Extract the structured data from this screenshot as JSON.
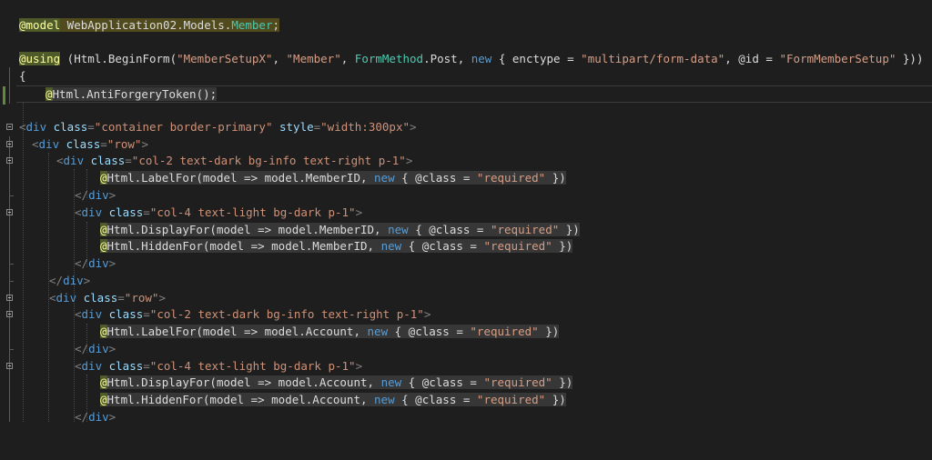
{
  "editor": {
    "lines": {
      "l1": {
        "at": "@model",
        "text": " WebApplication02.Models.",
        "type": "Member",
        "semi": ";"
      },
      "l2": {
        "at": "@using",
        "a": " (Html.BeginForm(",
        "s1": "\"MemberSetupX\"",
        "b": ", ",
        "s2": "\"Member\"",
        "c": ", ",
        "t1": "FormMethod",
        "d": ".Post, ",
        "k1": "new",
        "e": " { enctype = ",
        "s3": "\"multipart/form-data\"",
        "f": ", @id = ",
        "s4": "\"FormMemberSetup\"",
        "g": " }))"
      },
      "l3": {
        "brace": "{"
      },
      "l4": {
        "at": "@",
        "text": "Html.AntiForgeryToken();"
      },
      "l5": {
        "open": "<",
        "tag": "div",
        "a1": " class",
        "eq1": "=",
        "v1": "\"container border-primary\"",
        "a2": " style",
        "eq2": "=",
        "v2": "\"width:300px\"",
        "close": ">"
      },
      "l6": {
        "open": "<",
        "tag": "div",
        "a1": " class",
        "eq1": "=",
        "v1": "\"row\"",
        "close": ">"
      },
      "l7": {
        "open": "<",
        "tag": "div",
        "a1": " class",
        "eq1": "=",
        "v1": "\"col-2 text-dark bg-info text-right p-1\"",
        "close": ">"
      },
      "l8": {
        "at": "@",
        "text": "Html.LabelFor(model => model.MemberID, ",
        "k": "new",
        "rest": " { @class = ",
        "s": "\"required\"",
        "end": " })"
      },
      "l9": {
        "open": "</",
        "tag": "div",
        "close": ">"
      },
      "l10": {
        "open": "<",
        "tag": "div",
        "a1": " class",
        "eq1": "=",
        "v1": "\"col-4 text-light bg-dark p-1\"",
        "close": ">"
      },
      "l11": {
        "at": "@",
        "text": "Html.DisplayFor(model => model.MemberID, ",
        "k": "new",
        "rest": " { @class = ",
        "s": "\"required\"",
        "end": " })"
      },
      "l12": {
        "at": "@",
        "text": "Html.HiddenFor(model => model.MemberID, ",
        "k": "new",
        "rest": " { @class = ",
        "s": "\"required\"",
        "end": " })"
      },
      "l13": {
        "open": "</",
        "tag": "div",
        "close": ">"
      },
      "l14": {
        "open": "</",
        "tag": "div",
        "close": ">"
      },
      "l15": {
        "open": "<",
        "tag": "div",
        "a1": " class",
        "eq1": "=",
        "v1": "\"row\"",
        "close": ">"
      },
      "l16": {
        "open": "<",
        "tag": "div",
        "a1": " class",
        "eq1": "=",
        "v1": "\"col-2 text-dark bg-info text-right p-1\"",
        "close": ">"
      },
      "l17": {
        "at": "@",
        "text": "Html.LabelFor(model => model.Account, ",
        "k": "new",
        "rest": " { @class = ",
        "s": "\"required\"",
        "end": " })"
      },
      "l18": {
        "open": "</",
        "tag": "div",
        "close": ">"
      },
      "l19": {
        "open": "<",
        "tag": "div",
        "a1": " class",
        "eq1": "=",
        "v1": "\"col-4 text-light bg-dark p-1\"",
        "close": ">"
      },
      "l20": {
        "at": "@",
        "text": "Html.DisplayFor(model => model.Account, ",
        "k": "new",
        "rest": " { @class = ",
        "s": "\"required\"",
        "end": " })"
      },
      "l21": {
        "at": "@",
        "text": "Html.HiddenFor(model => model.Account, ",
        "k": "new",
        "rest": " { @class = ",
        "s": "\"required\"",
        "end": " })"
      },
      "l22": {
        "open": "</",
        "tag": "div",
        "close": ">"
      }
    },
    "colors": {
      "background": "#1e1e1e",
      "text": "#dcdcdc",
      "keyword": "#569cd6",
      "type": "#4ec9b0",
      "razor_string": "#d69d85",
      "html_attribute_value": "#ce9178",
      "html_attribute_name": "#9cdcfe",
      "razor_marker_background": "#4e5a2a",
      "changed_line_marker": "#5b8c3a"
    }
  }
}
